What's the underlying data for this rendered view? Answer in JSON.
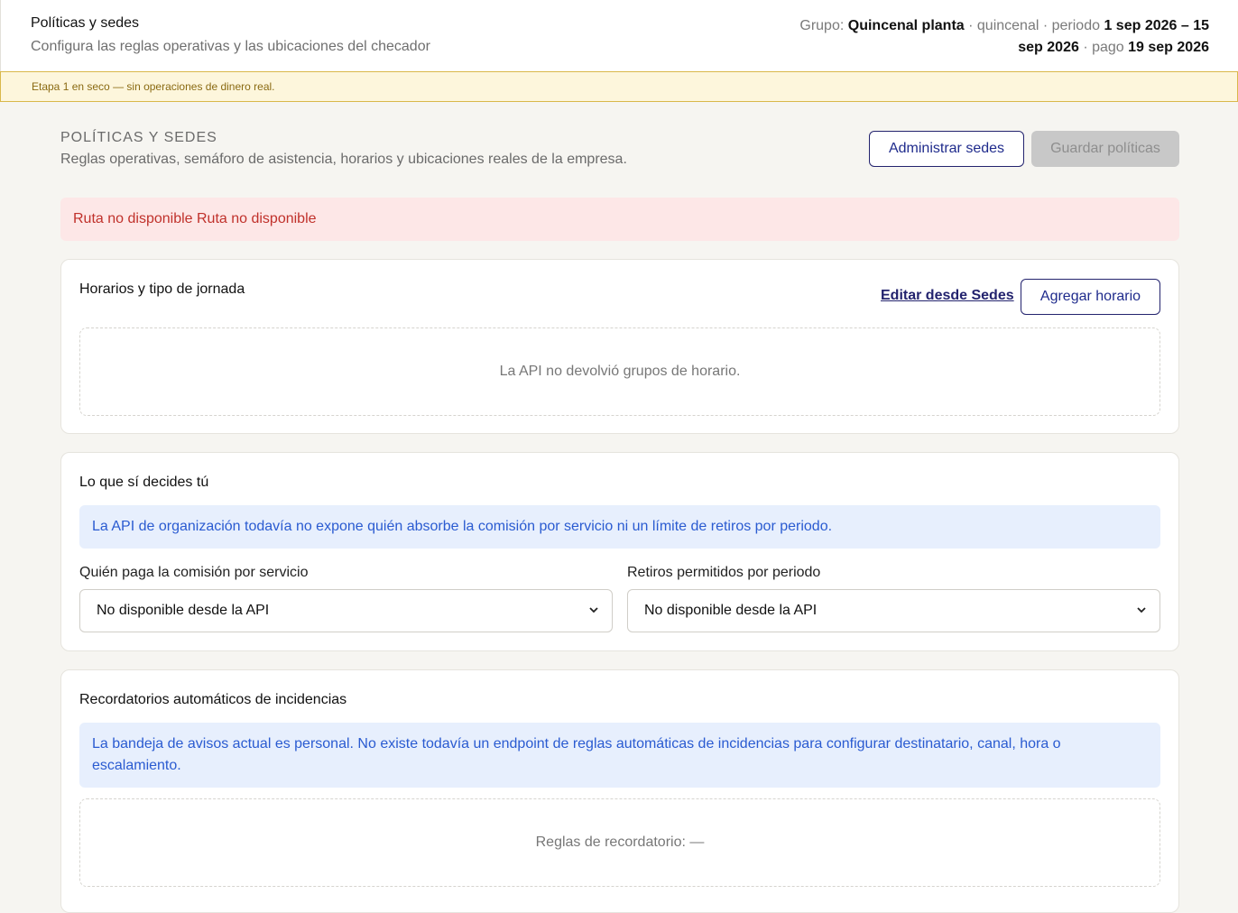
{
  "header": {
    "title": "Políticas y sedes",
    "subtitle": "Configura las reglas operativas y las ubicaciones del checador",
    "group_label": "Grupo:",
    "group_name": "Quincenal planta",
    "frequency": "· quincenal · periodo",
    "period": "1 sep 2026 – 15 sep 2026",
    "pay_label": "· pago",
    "pay_date": "19 sep 2026"
  },
  "banner": {
    "text": "Etapa 1 en seco — sin operaciones de dinero real."
  },
  "page": {
    "section_label": "Políticas y sedes",
    "description": "Reglas operativas, semáforo de asistencia, horarios y ubicaciones reales de la empresa.",
    "manage_sites_label": "Administrar sedes",
    "save_policies_label": "Guardar políticas"
  },
  "error": {
    "text": "Ruta no disponible Ruta no disponible"
  },
  "schedules": {
    "title": "Horarios y tipo de jornada",
    "edit_link": "Editar desde Sedes",
    "add_button": "Agregar horario",
    "empty_text": "La API no devolvió grupos de horario."
  },
  "decisions": {
    "title": "Lo que sí decides tú",
    "info": "La API de organización todavía no expone quién absorbe la comisión por servicio ni un límite de retiros por periodo.",
    "fee_label": "Quién paga la comisión por servicio",
    "fee_value": "No disponible desde la API",
    "withdrawals_label": "Retiros permitidos por periodo",
    "withdrawals_value": "No disponible desde la API"
  },
  "reminders": {
    "title": "Recordatorios automáticos de incidencias",
    "info": "La bandeja de avisos actual es personal. No existe todavía un endpoint de reglas automáticas de incidencias para configurar destinatario, canal, hora o escalamiento.",
    "rules_text": "Reglas de recordatorio: —"
  },
  "colors": {
    "accent": "#23236e",
    "error_bg": "#fde7e7",
    "error_text": "#c0312b",
    "info_bg": "#e7effd",
    "info_text": "#2a5bd1",
    "warning_bg": "#fdf6dc"
  },
  "icons": {
    "select_chevron": "chevron-down-icon"
  }
}
